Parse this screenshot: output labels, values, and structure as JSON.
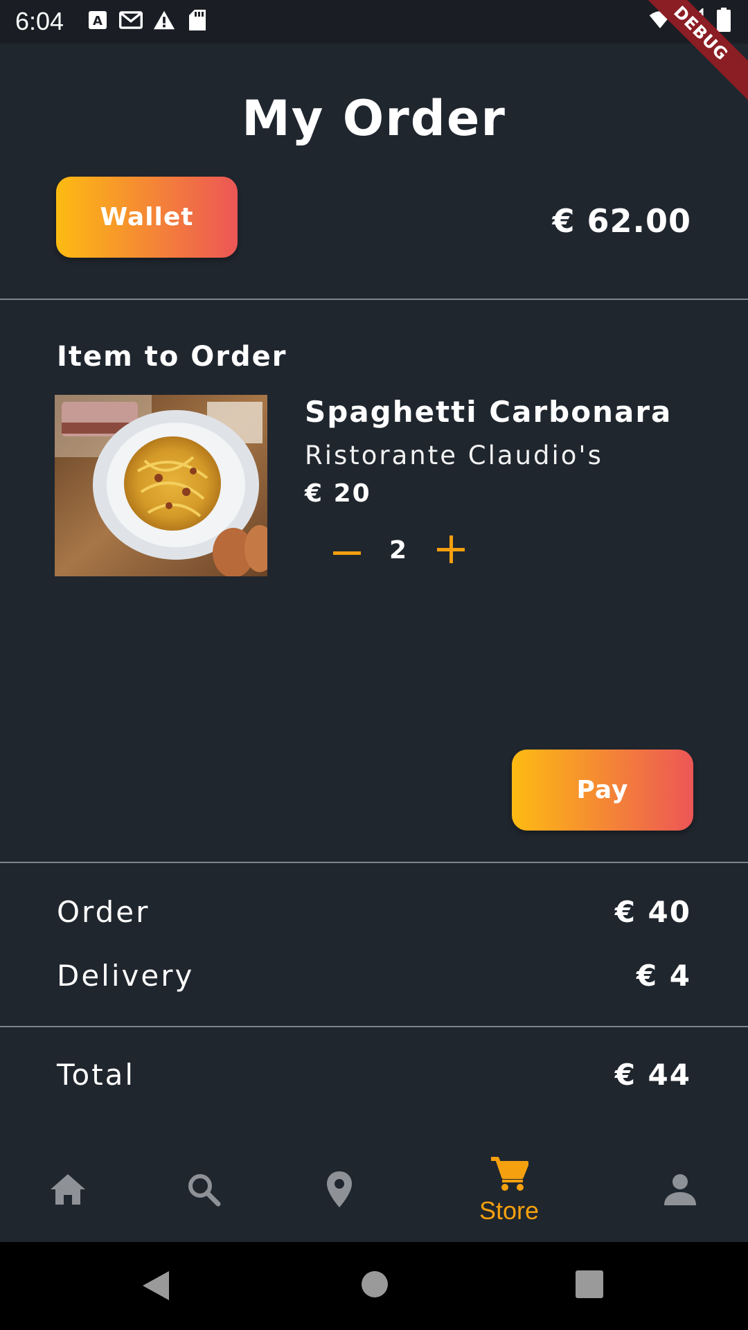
{
  "status_bar": {
    "time": "6:04",
    "left_icons": [
      "a-notification-icon",
      "gmail-icon",
      "warning-icon",
      "sd-card-icon"
    ],
    "right_icons": [
      "wifi-icon",
      "signal-icon",
      "battery-icon"
    ]
  },
  "debug_banner": "DEBUG",
  "header": {
    "title": "My Order"
  },
  "wallet": {
    "button_label": "Wallet",
    "amount": "€ 62.00"
  },
  "order_section": {
    "title": "Item to Order",
    "item": {
      "name": "Spaghetti Carbonara",
      "restaurant": "Ristorante Claudio's",
      "price": "€ 20",
      "quantity": "2"
    }
  },
  "pay_button": {
    "label": "Pay"
  },
  "summary": {
    "order_label": "Order",
    "order_value": "€ 40",
    "delivery_label": "Delivery",
    "delivery_value": "€ 4",
    "total_label": "Total",
    "total_value": "€ 44"
  },
  "bottom_nav": {
    "items": [
      {
        "icon": "home-icon",
        "label": ""
      },
      {
        "icon": "search-icon",
        "label": ""
      },
      {
        "icon": "location-pin-icon",
        "label": ""
      },
      {
        "icon": "cart-icon",
        "label": "Store",
        "active": true
      },
      {
        "icon": "person-icon",
        "label": ""
      }
    ]
  },
  "colors": {
    "background": "#20262e",
    "accent": "#f5a00f",
    "gradient_start": "#fdbb12",
    "gradient_end": "#ec5656",
    "inactive_icon": "#8e9297"
  }
}
